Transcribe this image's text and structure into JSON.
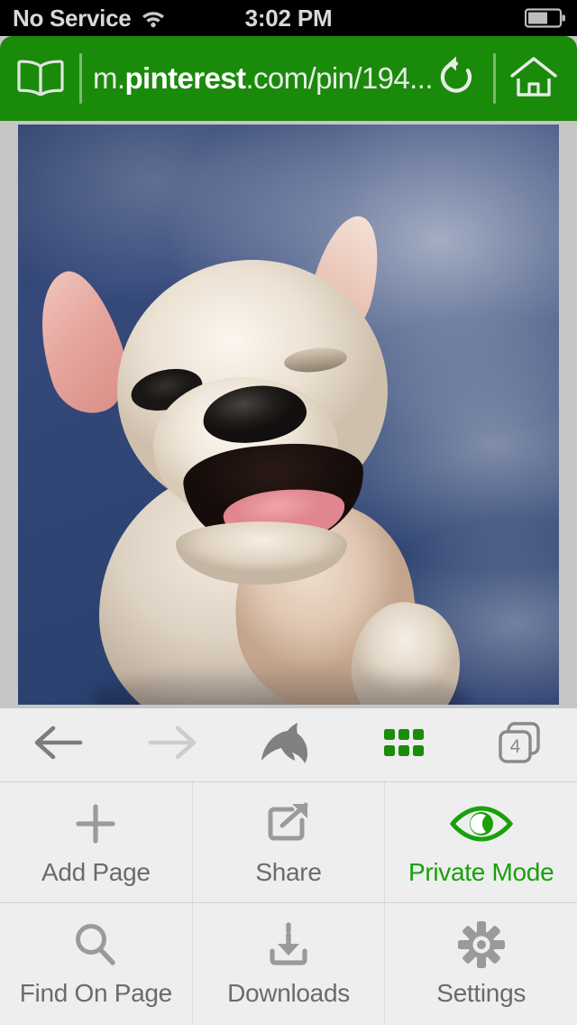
{
  "status_bar": {
    "carrier": "No Service",
    "wifi_icon": "wifi-icon",
    "time": "3:02 PM",
    "battery_icon": "battery-icon",
    "battery_level_percent": 58
  },
  "browser": {
    "accent_color": "#1a8a0a",
    "url_bar": {
      "bookmarks_icon": "book-icon",
      "url_prefix": "m.",
      "url_domain": "pinterest",
      "url_suffix": ".com/pin/194...",
      "url_full": "m.pinterest.com/pin/194...",
      "reload_icon": "reload-icon",
      "home_icon": "home-icon"
    },
    "page": {
      "content_description": "photo of a white French bulldog puppy laughing against a blue sky with clouds"
    },
    "toolbar": {
      "back_icon": "back-arrow-icon",
      "back_enabled": true,
      "forward_icon": "forward-arrow-icon",
      "forward_enabled": false,
      "dolphin_icon": "dolphin-logo-icon",
      "grid_icon": "app-grid-icon",
      "tabs_icon": "tabs-icon",
      "tab_count": "4"
    },
    "menu": {
      "rows": [
        [
          {
            "label": "Add Page",
            "icon": "plus-icon",
            "active": false
          },
          {
            "label": "Share",
            "icon": "share-icon",
            "active": false
          },
          {
            "label": "Private Mode",
            "icon": "eye-icon",
            "active": true
          }
        ],
        [
          {
            "label": "Find On Page",
            "icon": "search-icon",
            "active": false
          },
          {
            "label": "Downloads",
            "icon": "download-icon",
            "active": false
          },
          {
            "label": "Settings",
            "icon": "gear-icon",
            "active": false
          }
        ]
      ],
      "active_color": "#19a00a",
      "inactive_color": "#8c8c8c"
    }
  }
}
